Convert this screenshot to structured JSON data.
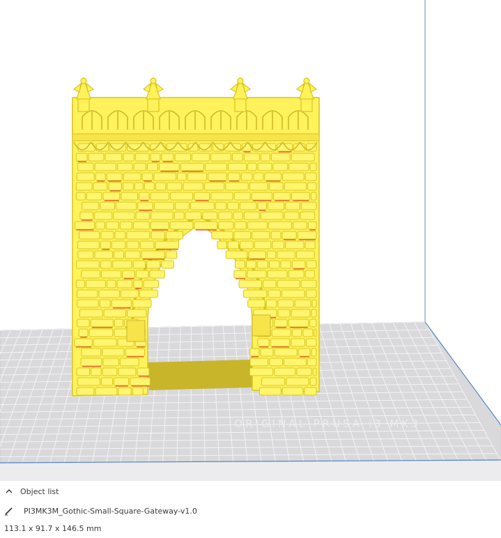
{
  "object_panel": {
    "header_label": "Object list",
    "toggle_icon": "chevron-up-icon",
    "edit_icon": "pencil-icon",
    "object_name": "PI3MK3M_Gothic-Small-Square-Gateway-v1.0",
    "dimensions": "113.1 x 91.7 x 146.5 mm"
  },
  "colors": {
    "model": "#fff25a",
    "model_shadow": "#d9c51f",
    "model_edge": "#e0312a",
    "bed": "#d9d9db",
    "bed_grid": "#f2f2f4",
    "volume_edge": "#5a88c8"
  },
  "viewport": {
    "bed_logo_text": "ORIGINAL PRUSA i3 MK3"
  }
}
